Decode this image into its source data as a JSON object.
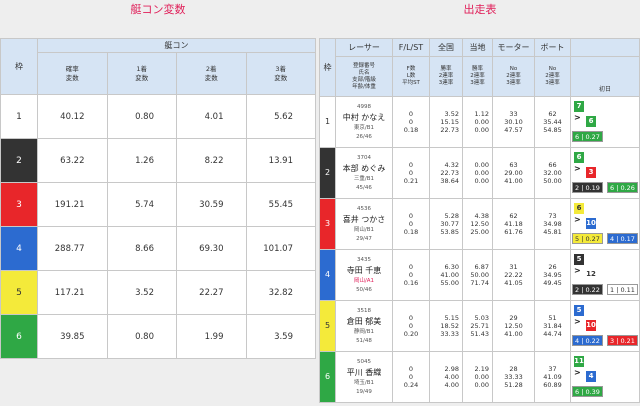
{
  "section_left": "艇コン変数",
  "section_right": "出走表",
  "left_table": {
    "waku_label": "枠",
    "group_label": "艇コン",
    "columns": [
      "確率\n変数",
      "1着\n変数",
      "2着\n変数",
      "3着\n変数"
    ],
    "rows": [
      {
        "waku": "1",
        "values": [
          "40.12",
          "0.80",
          "4.01",
          "5.62"
        ]
      },
      {
        "waku": "2",
        "values": [
          "63.22",
          "1.26",
          "8.22",
          "13.91"
        ]
      },
      {
        "waku": "3",
        "values": [
          "191.21",
          "5.74",
          "30.59",
          "55.45"
        ]
      },
      {
        "waku": "4",
        "values": [
          "288.77",
          "8.66",
          "69.30",
          "101.07"
        ]
      },
      {
        "waku": "5",
        "values": [
          "117.21",
          "3.52",
          "22.27",
          "32.82"
        ]
      },
      {
        "waku": "6",
        "values": [
          "39.85",
          "0.80",
          "1.99",
          "3.59"
        ]
      }
    ]
  },
  "right_table": {
    "waku_label": "枠",
    "headers": [
      "レーサー",
      "F/L/ST",
      "全国",
      "当地",
      "モーター",
      "ボート"
    ],
    "sub": [
      "登録番号\n氏名\n支部/階級\n年齢/体重",
      "F数\nL数\n平均ST",
      "勝率\n2連率\n3連率",
      "勝率\n2連率\n3連率",
      "No\n2連率\n3連率",
      "No\n2連率\n3連率"
    ],
    "day_label": "初日",
    "rows": [
      {
        "waku": "1",
        "id": "4998",
        "name": "中村 かなえ",
        "branch": "東京/B1",
        "age": "26/46",
        "f": "0",
        "l": "0",
        "st": "0.18",
        "z": [
          "3.52",
          "15.15",
          "22.73"
        ],
        "t": [
          "1.12",
          "0.00",
          "0.00"
        ],
        "m": [
          "33",
          "30.10",
          "47.57"
        ],
        "b": [
          "62",
          "35.44",
          "54.85"
        ],
        "s": {
          "c1": "7",
          "c1c": "b6",
          "ar": ">",
          "c2": "6",
          "c2c": "b6",
          "bar": "6 | 0.27",
          "barc": "b6"
        }
      },
      {
        "waku": "2",
        "id": "3704",
        "name": "本部 めぐみ",
        "branch": "三重/B1",
        "age": "45/46",
        "f": "0",
        "l": "0",
        "st": "0.21",
        "z": [
          "4.32",
          "22.73",
          "38.64"
        ],
        "t": [
          "0.00",
          "0.00",
          "0.00"
        ],
        "m": [
          "63",
          "29.00",
          "41.00"
        ],
        "b": [
          "66",
          "32.00",
          "50.00"
        ],
        "s": {
          "c1": "6",
          "c1c": "b6",
          "ar": ">",
          "c2": "3",
          "c2c": "b3",
          "bar": "2 | 0.19",
          "barc": "b2",
          "bar2": "6 | 0.26",
          "bar2c": "b6"
        }
      },
      {
        "waku": "3",
        "id": "4536",
        "name": "喜井 つかさ",
        "branch": "岡山/B1",
        "age": "29/47",
        "f": "0",
        "l": "0",
        "st": "0.18",
        "z": [
          "5.28",
          "30.77",
          "53.85"
        ],
        "t": [
          "4.38",
          "12.50",
          "25.00"
        ],
        "m": [
          "62",
          "41.18",
          "61.76"
        ],
        "b": [
          "73",
          "34.98",
          "45.81"
        ],
        "s": {
          "c1": "6",
          "c1c": "b5",
          "ar": ">",
          "c2": "10",
          "c2c": "b4",
          "bar": "5 | 0.27",
          "barc": "b5",
          "bar2": "4 | 0.17",
          "bar2c": "b4"
        }
      },
      {
        "waku": "4",
        "id": "3435",
        "name": "寺田 千恵",
        "branch": "岡山/A1",
        "age": "50/46",
        "f": "0",
        "l": "0",
        "st": "0.16",
        "z": [
          "6.30",
          "41.00",
          "55.00"
        ],
        "t": [
          "6.87",
          "50.00",
          "71.74"
        ],
        "m": [
          "31",
          "22.22",
          "41.05"
        ],
        "b": [
          "26",
          "34.95",
          "49.45"
        ],
        "s": {
          "c1": "5",
          "c1c": "b2",
          "ar": ">",
          "c2": "12",
          "c2c": "b1",
          "bar": "2 | 0.22",
          "barc": "b2",
          "bar2": "1 | 0.11",
          "bar2c": "b1"
        }
      },
      {
        "waku": "5",
        "id": "3518",
        "name": "倉田 郁美",
        "branch": "静岡/B1",
        "age": "51/48",
        "f": "0",
        "l": "0",
        "st": "0.20",
        "z": [
          "5.15",
          "18.52",
          "33.33"
        ],
        "t": [
          "5.03",
          "25.71",
          "51.43"
        ],
        "m": [
          "29",
          "12.50",
          "41.00"
        ],
        "b": [
          "51",
          "31.84",
          "44.74"
        ],
        "s": {
          "c1": "5",
          "c1c": "b4",
          "ar": ">",
          "c2": "10",
          "c2c": "b3",
          "bar": "4 | 0.22",
          "barc": "b4",
          "bar2": "3 | 0.21",
          "bar2c": "b3"
        }
      },
      {
        "waku": "6",
        "id": "5045",
        "name": "平川 香織",
        "branch": "埼玉/B1",
        "age": "19/49",
        "f": "0",
        "l": "0",
        "st": "0.24",
        "z": [
          "2.98",
          "4.00",
          "4.00"
        ],
        "t": [
          "2.19",
          "0.00",
          "0.00"
        ],
        "m": [
          "28",
          "33.33",
          "51.28"
        ],
        "b": [
          "37",
          "41.09",
          "60.89"
        ],
        "s": {
          "c1": "11",
          "c1c": "b6",
          "ar": ">",
          "c2": "4",
          "c2c": "b4",
          "bar": "6 | 0.39",
          "barc": "b6"
        }
      }
    ]
  }
}
